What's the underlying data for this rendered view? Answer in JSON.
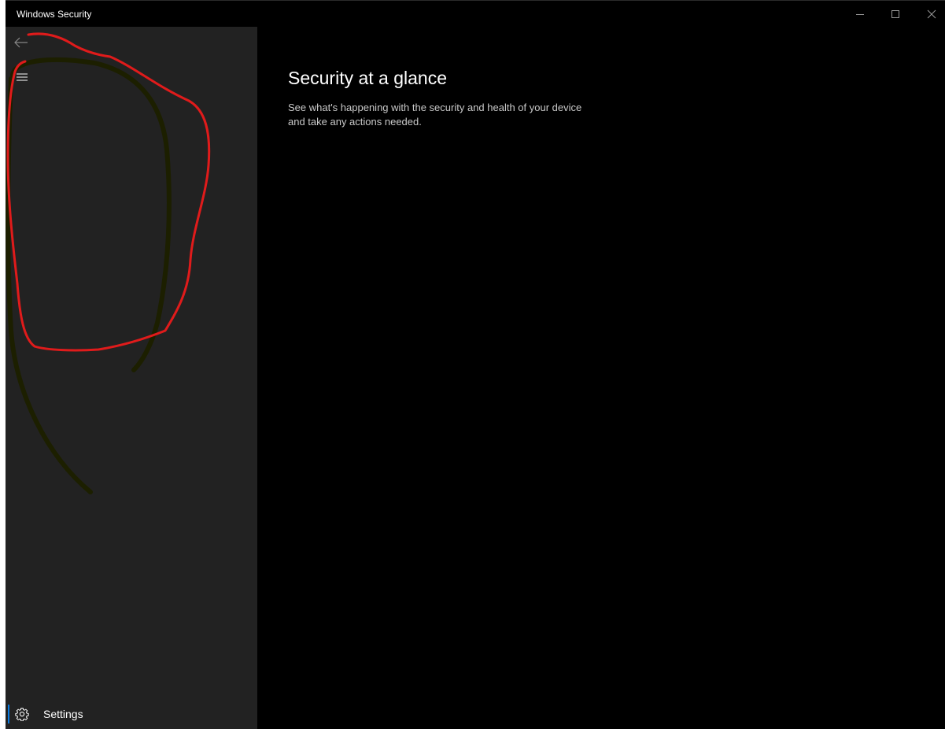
{
  "window": {
    "title": "Windows Security"
  },
  "sidebar": {
    "back_icon": "back-arrow-icon",
    "menu_icon": "hamburger-menu-icon",
    "settings": {
      "label": "Settings",
      "icon": "gear-icon"
    }
  },
  "main": {
    "title": "Security at a glance",
    "description_line1": "See what's happening with the security and health of your device",
    "description_line2": "and take any actions needed."
  },
  "colors": {
    "sidebar_bg": "#222222",
    "main_bg": "#000000",
    "accent": "#0a7adf",
    "annotation_red": "#e01b1b",
    "annotation_dark": "#1c1f00"
  }
}
